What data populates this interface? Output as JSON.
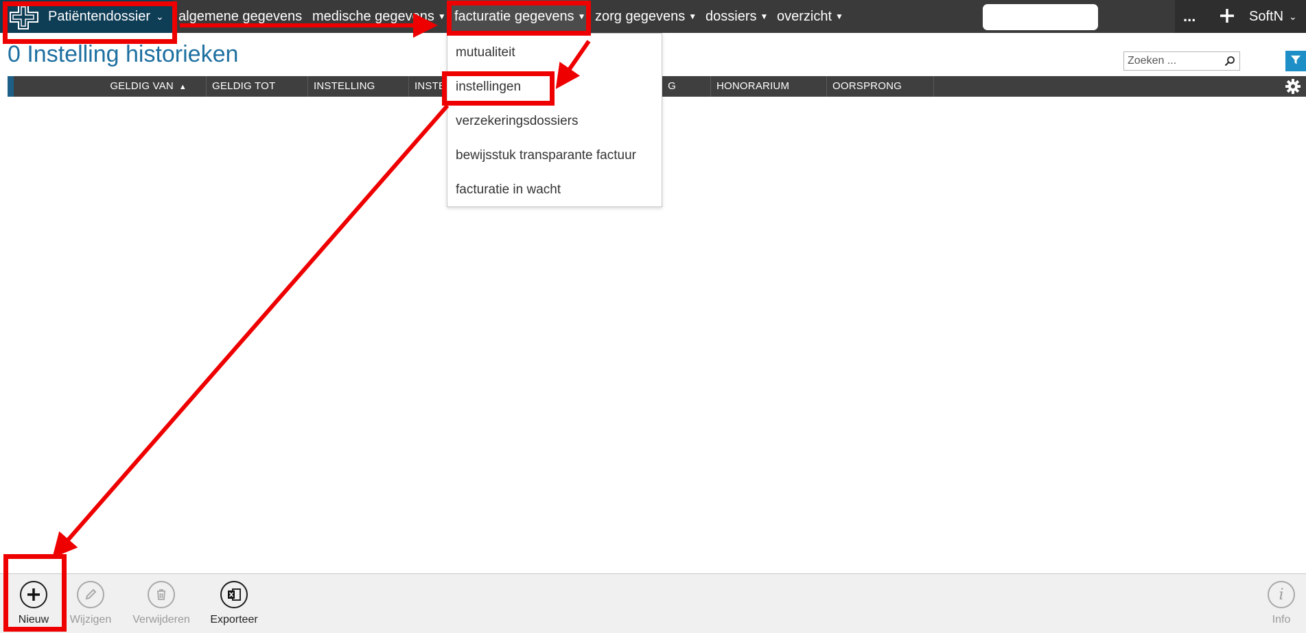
{
  "topbar": {
    "brand": "Patiëntendossier",
    "nav": [
      {
        "label": "algemene gegevens",
        "has_caret": false
      },
      {
        "label": "medische gegevens",
        "has_caret": true
      },
      {
        "label": "facturatie gegevens",
        "has_caret": true,
        "active": true
      },
      {
        "label": "zorg gegevens",
        "has_caret": true
      },
      {
        "label": "dossiers",
        "has_caret": true
      },
      {
        "label": "overzicht",
        "has_caret": true
      }
    ],
    "more": "...",
    "user": "SoftN"
  },
  "page": {
    "title": "0 Instelling historieken",
    "search_placeholder": "Zoeken ..."
  },
  "table": {
    "columns": [
      "GELDIG VAN",
      "GELDIG TOT",
      "INSTELLING",
      "INSTEL",
      "G",
      "HONORARIUM",
      "OORSPRONG"
    ],
    "sorted_column": "GELDIG VAN",
    "sort_direction": "ascending"
  },
  "dropdown": {
    "items": [
      "mutualiteit",
      "instellingen",
      "verzekeringsdossiers",
      "bewijsstuk transparante factuur",
      "facturatie in wacht"
    ]
  },
  "toolbar": {
    "new": "Nieuw",
    "edit": "Wijzigen",
    "delete": "Verwijderen",
    "export": "Exporteer",
    "info": "Info"
  },
  "colors": {
    "annotation": "#ee0000",
    "brand_bg": "#0e3d56",
    "title": "#1d6fa0",
    "topbar": "#3a3a3a"
  }
}
